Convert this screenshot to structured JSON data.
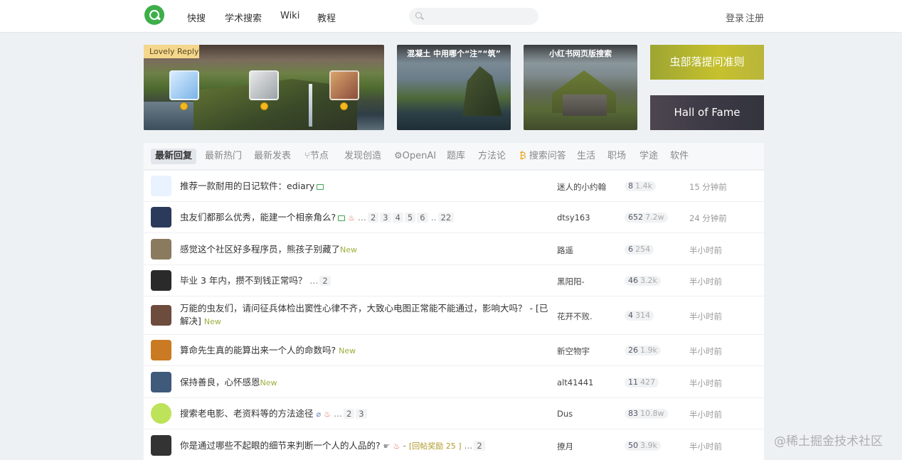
{
  "header": {
    "nav": [
      "快搜",
      "学术搜索",
      "Wiki",
      "教程"
    ],
    "search_placeholder": "",
    "login": "登录",
    "register": "注册"
  },
  "banners": {
    "lovely_reply": "Lovely Reply",
    "b2_caption": "混凝土 中用哪个“注”“筑”",
    "b3_caption": "小红书网页版搜索",
    "tile1": "虫部落提问准则",
    "tile2": "Hall of Fame"
  },
  "tabs": [
    "最新回复",
    "最新热门",
    "最新发表",
    "节点",
    "发现创造",
    "OpenAI",
    "题库",
    "方法论",
    "搜索问答",
    "生活",
    "职场",
    "学途",
    "软件"
  ],
  "threads": [
    {
      "title": "推荐一款耐用的日记软件：ediary",
      "author": "迷人的小约翰",
      "replies": "8",
      "views": "1.4k",
      "time": "15 分钟前",
      "avatar_color": "#e9f2ff"
    },
    {
      "title": "虫友们都那么优秀，能建一个相亲角么?",
      "pages": [
        "2",
        "3",
        "4",
        "5",
        "6",
        "22"
      ],
      "author": "dtsy163",
      "replies": "652",
      "views": "7.2w",
      "time": "24 分钟前",
      "avatar_color": "#2b3a5a"
    },
    {
      "title": "感觉这个社区好多程序员，熊孩子别藏了",
      "new": "New",
      "author": "路遥",
      "replies": "6",
      "views": "254",
      "time": "半小时前",
      "avatar_color": "#8a7b5e"
    },
    {
      "title": "毕业 3 年内，攒不到钱正常吗？",
      "pages": [
        "2"
      ],
      "author": "黑阳阳-",
      "replies": "46",
      "views": "3.2k",
      "time": "半小时前",
      "avatar_color": "#2a2a2a"
    },
    {
      "title": "万能的虫友们，请问征兵体检出窦性心律不齐，大致心电图正常能不能通过，影响大吗？ - [已解决]",
      "new": "New",
      "author": "花开不败.",
      "replies": "4",
      "views": "314",
      "time": "半小时前",
      "avatar_color": "#6d4b3d"
    },
    {
      "title": "算命先生真的能算出来一个人的命数吗?",
      "new": "New",
      "author": "新空物宇",
      "replies": "26",
      "views": "1.9k",
      "time": "半小时前",
      "avatar_color": "#c97a22"
    },
    {
      "title": "保持善良，心怀感恩",
      "new": "New",
      "author": "alt41441",
      "replies": "11",
      "views": "427",
      "time": "半小时前",
      "avatar_color": "#3f5a7a"
    },
    {
      "title": "搜索老电影、老资料等的方法途径",
      "pages": [
        "2",
        "3"
      ],
      "author": "Dus",
      "replies": "83",
      "views": "10.8w",
      "time": "半小时前",
      "avatar_color": "#bde35a"
    },
    {
      "title": "你是通过哪些不起眼的细节来判断一个人的人品的?",
      "reward": "[回帖奖励 25 ]",
      "pages": [
        "2"
      ],
      "author": "撩月",
      "replies": "50",
      "views": "3.9k",
      "time": "半小时前",
      "avatar_color": "#333333"
    }
  ],
  "watermark": "@稀土掘金技术社区"
}
